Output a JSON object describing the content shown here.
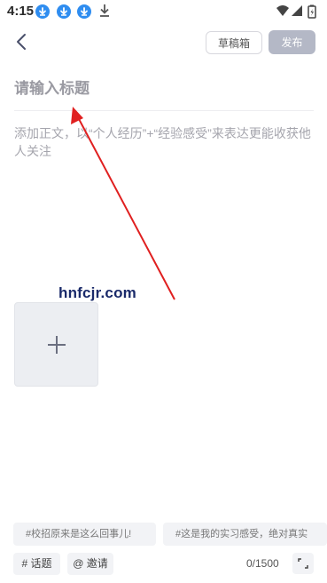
{
  "status_bar": {
    "time": "4:15",
    "icons": [
      "download-icon",
      "download-icon",
      "download-icon",
      "download-plain-icon",
      "wifi-icon",
      "signal-icon",
      "battery-icon"
    ]
  },
  "header": {
    "draft_label": "草稿箱",
    "publish_label": "发布"
  },
  "editor": {
    "title_placeholder": "请输入标题",
    "body_placeholder": "添加正文，以“个人经历”+“经验感受”来表达更能收获他人关注"
  },
  "watermark": "hnfcjr.com",
  "suggestions": [
    "#校招原来是这么回事儿!",
    "#这是我的实习感受，绝对真实"
  ],
  "toolbar": {
    "topic_label": "# 话题",
    "invite_label": "@ 邀请",
    "counter": "0/1500"
  },
  "colors": {
    "accent_download": "#2f8df0",
    "publish_disabled": "#b4b8c6",
    "arrow": "#e02020"
  }
}
